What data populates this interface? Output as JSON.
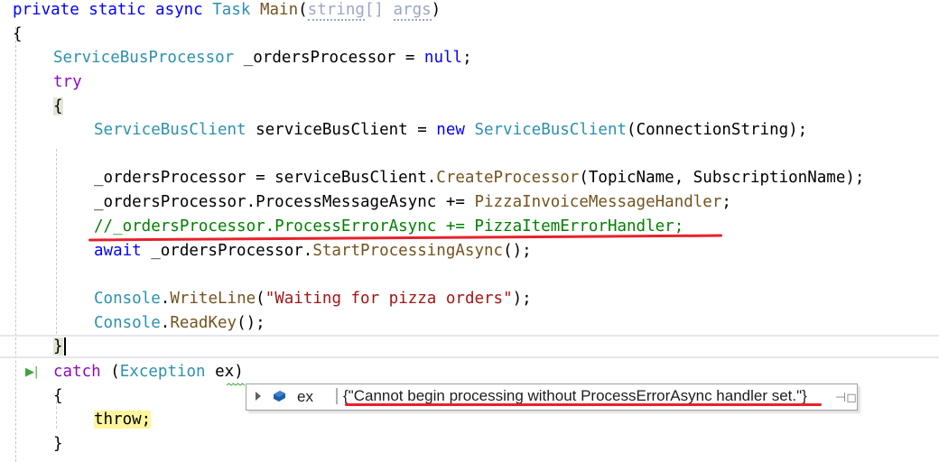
{
  "editor": {
    "lines": {
      "l1": {
        "p1": "private static async ",
        "p2": "Task",
        "p3": " ",
        "p4": "Main",
        "p5": "(",
        "p6": "string",
        "p7": "[] ",
        "p8": "args",
        "p9": ")"
      },
      "l2": {
        "t": "{"
      },
      "l3": {
        "p1": "ServiceBusProcessor",
        "p2": " _ordersProcessor = ",
        "p3": "null",
        "p4": ";"
      },
      "l4": {
        "t": "try"
      },
      "l5": {
        "t": "{"
      },
      "l6": {
        "p1": "ServiceBusClient",
        "p2": " serviceBusClient = ",
        "p3": "new ",
        "p4": "ServiceBusClient",
        "p5": "(ConnectionString);"
      },
      "l7": {
        "p1": "_ordersProcessor = serviceBusClient.",
        "p2": "CreateProcessor",
        "p3": "(TopicName, SubscriptionName);"
      },
      "l8": {
        "p1": "_ordersProcessor.ProcessMessageAsync += ",
        "p2": "PizzaInvoiceMessageHandler",
        "p3": ";"
      },
      "l9": {
        "t": "//_ordersProcessor.ProcessErrorAsync += PizzaItemErrorHandler;"
      },
      "l10": {
        "p1": "await ",
        "p2": "_ordersProcessor.",
        "p3": "StartProcessingAsync",
        "p4": "();"
      },
      "l11": {
        "p1": "Console",
        ".": ".",
        "p2": "WriteLine",
        "p3": "(",
        "p4": "\"Waiting for pizza orders\"",
        "p5": ");"
      },
      "l12": {
        "p1": "Console",
        ".": ".",
        "p2": "ReadKey",
        "p3": "();"
      },
      "l13": {
        "t": "}"
      },
      "l14": {
        "p1": "catch",
        "p2": " (",
        "p3": "Exception",
        "p4": " ex)"
      },
      "l15": {
        "t": "{"
      },
      "l16": {
        "t": "throw;"
      },
      "l17": {
        "t": "}"
      }
    }
  },
  "datatip": {
    "variable_name": "ex",
    "value": "{\"Cannot begin processing without ProcessErrorAsync handler set.\"}",
    "expand_icon": "triangle-right-icon",
    "object_icon": "object-icon",
    "pin_icon": "pin-icon",
    "pin_glyph": "⊣◻"
  },
  "margin": {
    "run_to_here_glyph": "▶|"
  },
  "colors": {
    "annotation_red": "#e8212b",
    "keyword": "#0000ff",
    "control": "#8f08c4",
    "type": "#2b91af",
    "comment": "#008000",
    "string": "#a31515",
    "highlight_throw": "#fff59d"
  }
}
